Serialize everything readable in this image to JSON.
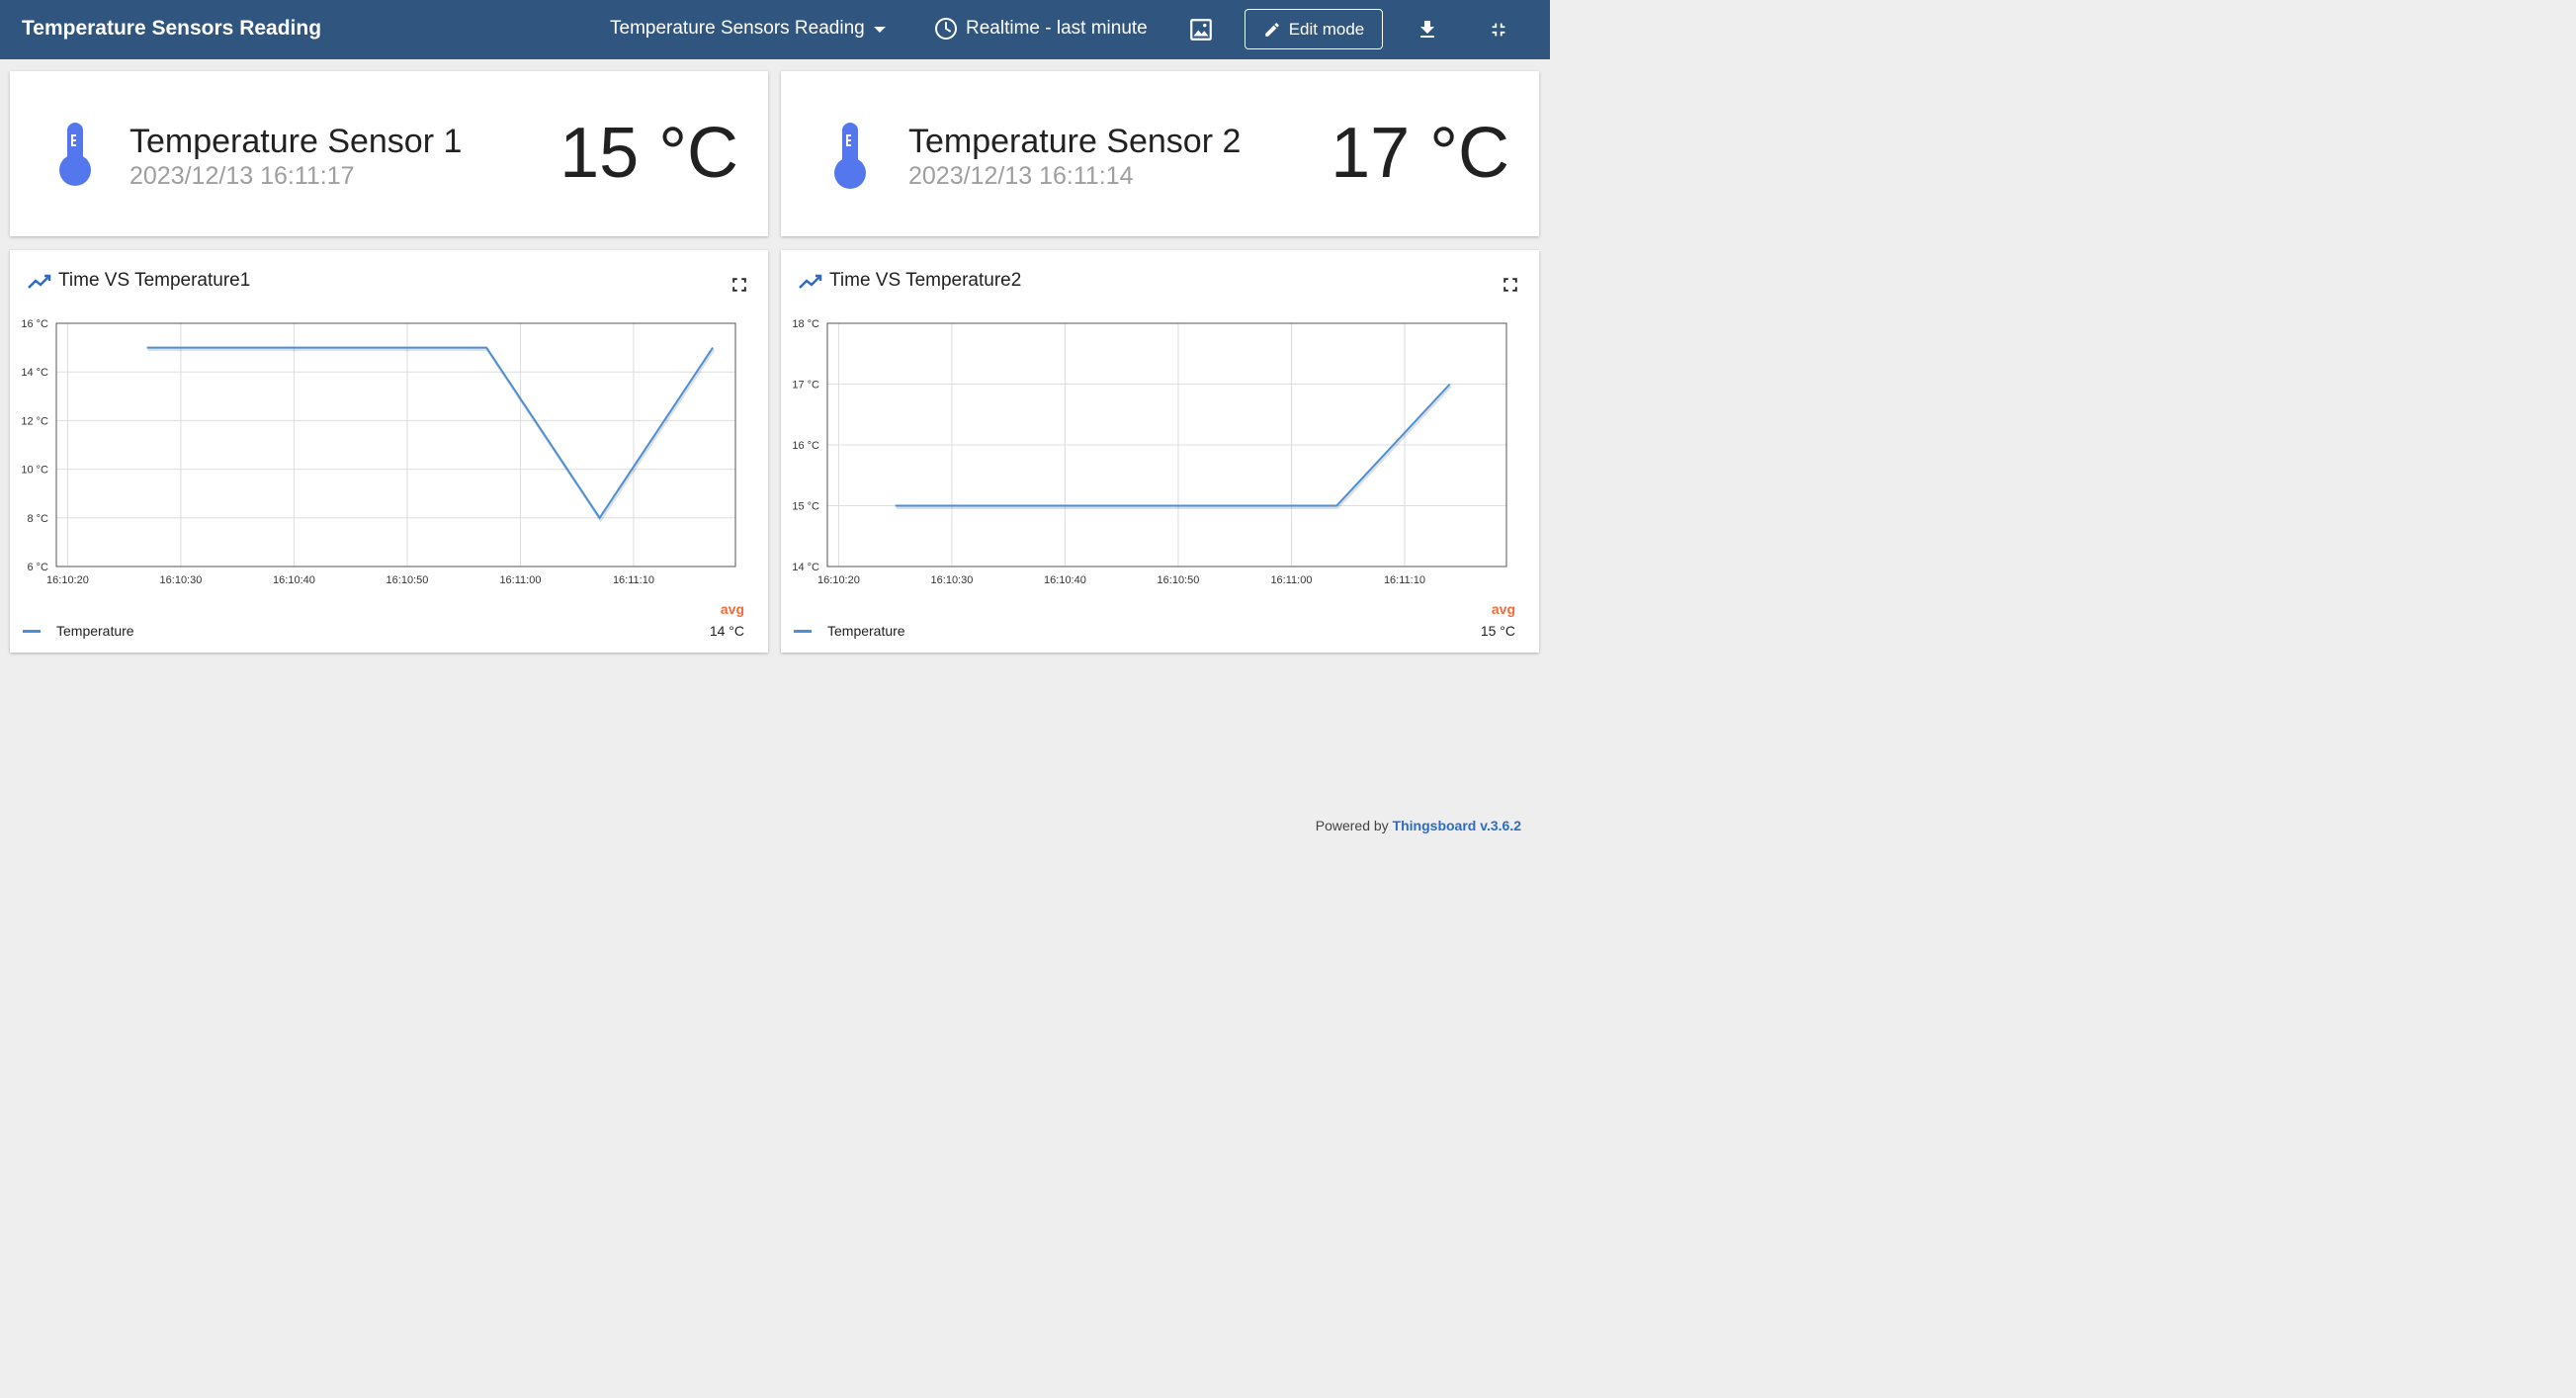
{
  "header": {
    "title": "Temperature Sensors Reading",
    "dashboard_selector": "Temperature Sensors Reading",
    "timewindow": "Realtime - last minute",
    "edit_mode_label": "Edit mode"
  },
  "sensors": [
    {
      "name": "Temperature Sensor 1",
      "timestamp": "2023/12/13 16:11:17",
      "value": "15 °C"
    },
    {
      "name": "Temperature Sensor 2",
      "timestamp": "2023/12/13 16:11:14",
      "value": "17 °C"
    }
  ],
  "charts": [
    {
      "title": "Time VS Temperature1",
      "legend": "Temperature",
      "avg_label": "avg",
      "avg_value": "14 °C"
    },
    {
      "title": "Time VS Temperature2",
      "legend": "Temperature",
      "avg_label": "avg",
      "avg_value": "15 °C"
    }
  ],
  "chart_data": [
    {
      "type": "line",
      "title": "Time VS Temperature1",
      "xlabel": "",
      "ylabel": "",
      "x_ticks": [
        "16:10:20",
        "16:10:30",
        "16:10:40",
        "16:10:50",
        "16:11:00",
        "16:11:10"
      ],
      "y_ticks": [
        "6 °C",
        "8 °C",
        "10 °C",
        "12 °C",
        "14 °C",
        "16 °C"
      ],
      "xlim": [
        "16:10:19",
        "16:11:19"
      ],
      "ylim": [
        6,
        16
      ],
      "grid": true,
      "legend": "bottom-left",
      "color": "#4a90d9",
      "series": [
        {
          "name": "Temperature",
          "x": [
            "16:10:27",
            "16:10:57",
            "16:11:07",
            "16:11:17"
          ],
          "y": [
            15,
            15,
            8,
            15
          ]
        }
      ]
    },
    {
      "type": "line",
      "title": "Time VS Temperature2",
      "xlabel": "",
      "ylabel": "",
      "x_ticks": [
        "16:10:20",
        "16:10:30",
        "16:10:40",
        "16:10:50",
        "16:11:00",
        "16:11:10"
      ],
      "y_ticks": [
        "14 °C",
        "15 °C",
        "16 °C",
        "17 °C",
        "18 °C"
      ],
      "xlim": [
        "16:10:19",
        "16:11:19"
      ],
      "ylim": [
        14,
        18
      ],
      "grid": true,
      "legend": "bottom-left",
      "color": "#4a90d9",
      "series": [
        {
          "name": "Temperature",
          "x": [
            "16:10:25",
            "16:11:04",
            "16:11:14"
          ],
          "y": [
            15,
            15,
            17
          ]
        }
      ]
    }
  ],
  "footer": {
    "prefix": "Powered by",
    "brand": "Thingsboard v.3.6.2"
  },
  "colors": {
    "header_bg": "#305680",
    "accent": "#4a90d9",
    "avg": "#f26b3a",
    "thermometer": "#5577ee"
  }
}
